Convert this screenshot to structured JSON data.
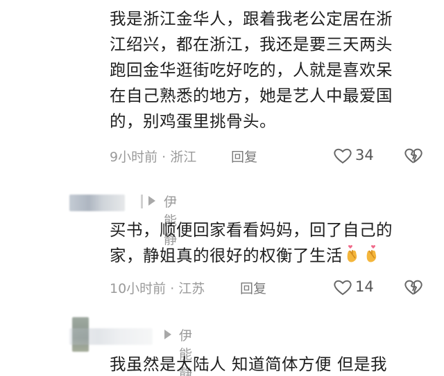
{
  "comments": [
    {
      "lines": [
        "我是浙江金华人，跟着我老公定居在浙",
        "江绍兴，都在浙江，我还是要三天两头",
        "跑回金华逛街吃好吃的，人就是喜欢呆",
        "在自己熟悉的地方，她是艺人中最爱国",
        "的，别鸡蛋里挑骨头。"
      ],
      "time_location": "9小时前 · 浙江",
      "reply_label": "回复",
      "likes": "34"
    },
    {
      "reply_to": "伊能静",
      "lines": [
        "买书，顺便回家看看妈妈，回了自己的",
        "家，静姐真的很好的权衡了生活"
      ],
      "time_location": "10小时前 · 江苏",
      "reply_label": "回复",
      "likes": "14"
    },
    {
      "reply_to": "伊能静",
      "lines": [
        "我虽然是大陆人 知道简体方便 但是我"
      ]
    }
  ],
  "colors": {
    "text": "#1e1e1e",
    "meta": "#9a9a9a",
    "icon": "#666666"
  }
}
